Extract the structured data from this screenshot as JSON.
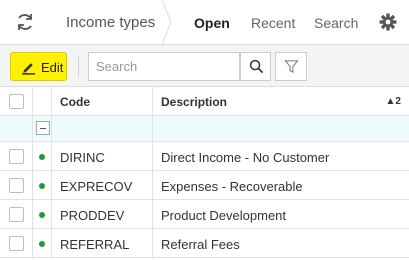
{
  "header": {
    "title": "Income types",
    "tabs": [
      {
        "label": "Open",
        "active": true
      },
      {
        "label": "Recent",
        "active": false
      },
      {
        "label": "Search",
        "active": false
      }
    ]
  },
  "toolbar": {
    "edit_label": "Edit",
    "search_placeholder": "Search",
    "accent_color": "#fff200"
  },
  "grid": {
    "columns": {
      "code": "Code",
      "description": "Description"
    },
    "sort_indicator": "▲2",
    "status_color": "#1e9b3a",
    "rows": [
      {
        "code": "DIRINC",
        "description": "Direct Income - No Customer"
      },
      {
        "code": "EXPRECOV",
        "description": "Expenses - Recoverable"
      },
      {
        "code": "PRODDEV",
        "description": "Product Development"
      },
      {
        "code": "REFERRAL",
        "description": "Referral Fees"
      }
    ]
  }
}
